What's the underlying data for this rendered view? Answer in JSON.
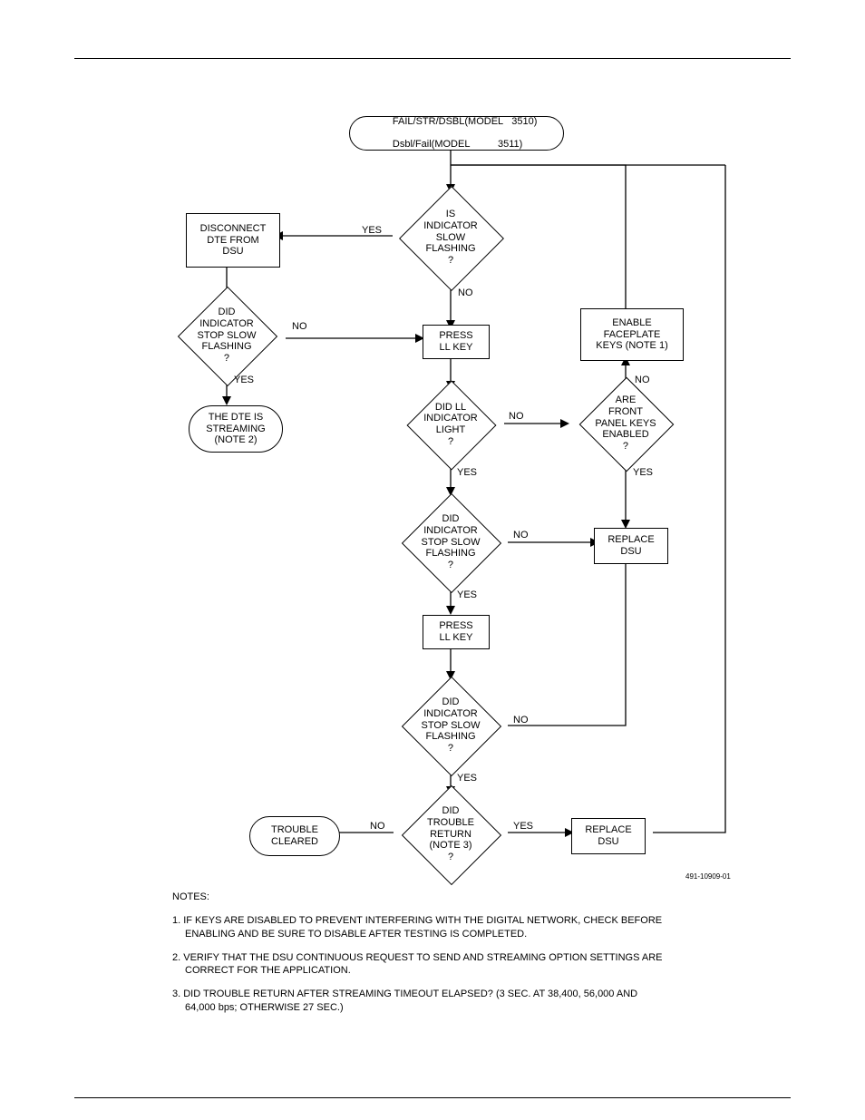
{
  "start": {
    "line1": "FAIL/STR/DSBL(MODEL   3510)",
    "line2": "Dsbl/Fail(MODEL          3511)"
  },
  "d_is_indicator": "IS\nINDICATOR\nSLOW\nFLASHING\n?",
  "r_disconnect": "DISCONNECT\nDTE FROM\nDSU",
  "d_did_stop1": "DID\nINDICATOR\nSTOP SLOW\nFLASHING\n?",
  "p_streaming": "THE DTE IS\nSTREAMING\n(NOTE 2)",
  "r_press_ll_1": "PRESS\nLL KEY",
  "d_did_ll_light": "DID LL\nINDICATOR\nLIGHT\n?",
  "d_are_keys": "ARE\nFRONT\nPANEL KEYS\nENABLED\n?",
  "r_enable_keys": "ENABLE\nFACEPLATE\nKEYS (NOTE 1)",
  "d_did_stop2": "DID\nINDICATOR\nSTOP SLOW\nFLASHING\n?",
  "r_replace1": "REPLACE\nDSU",
  "r_press_ll_2": "PRESS\nLL KEY",
  "d_did_stop3": "DID\nINDICATOR\nSTOP SLOW\nFLASHING\n?",
  "d_did_trouble": "DID\nTROUBLE\nRETURN\n(NOTE 3)\n?",
  "r_replace2": "REPLACE\nDSU",
  "p_trouble_cleared": "TROUBLE\nCLEARED",
  "labels": {
    "yes1": "YES",
    "no1": "NO",
    "no_left": "NO",
    "yes_left": "YES",
    "no2": "NO",
    "yes2": "YES",
    "yes_keys": "YES",
    "no_keys": "NO",
    "no3": "NO",
    "yes3": "YES",
    "no4": "NO",
    "yes4": "YES",
    "no5": "NO",
    "yes5": "YES"
  },
  "footer_code": "491-10909-01",
  "notes_title": "NOTES:",
  "note1a": "1. IF KEYS ARE DISABLED TO PREVENT INTERFERING WITH THE DIGITAL NETWORK, CHECK BEFORE",
  "note1b": "ENABLING AND BE SURE TO DISABLE AFTER TESTING IS COMPLETED.",
  "note2a": "2. VERIFY THAT THE DSU CONTINUOUS REQUEST TO SEND AND STREAMING OPTION SETTINGS ARE",
  "note2b": "CORRECT FOR THE APPLICATION.",
  "note3a": "3. DID TROUBLE RETURN AFTER STREAMING TIMEOUT ELAPSED? (3 SEC. AT 38,400, 56,000 AND",
  "note3b": "64,000 bps; OTHERWISE 27 SEC.)"
}
